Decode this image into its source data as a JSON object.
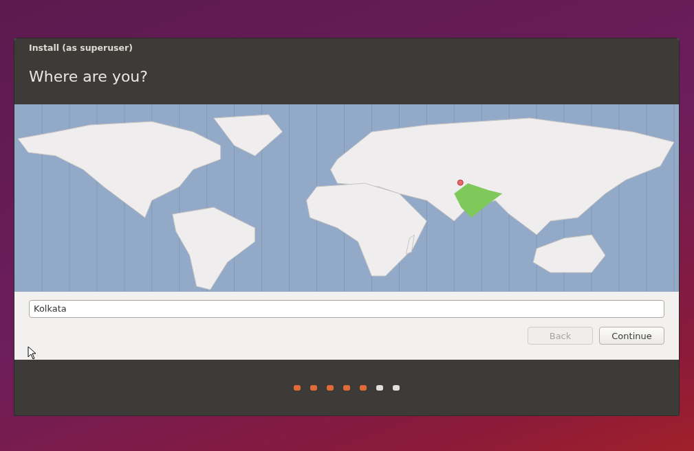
{
  "window": {
    "title": "Install (as superuser)"
  },
  "heading": "Where are you?",
  "location_field": {
    "value": "Kolkata"
  },
  "buttons": [
    {
      "label": "Back",
      "disabled": true
    },
    {
      "label": "Continue",
      "disabled": false
    }
  ],
  "progress_steps": [
    {
      "done": true
    },
    {
      "done": true
    },
    {
      "done": true
    },
    {
      "done": true
    },
    {
      "done": true
    },
    {
      "done": false
    },
    {
      "done": false
    }
  ]
}
